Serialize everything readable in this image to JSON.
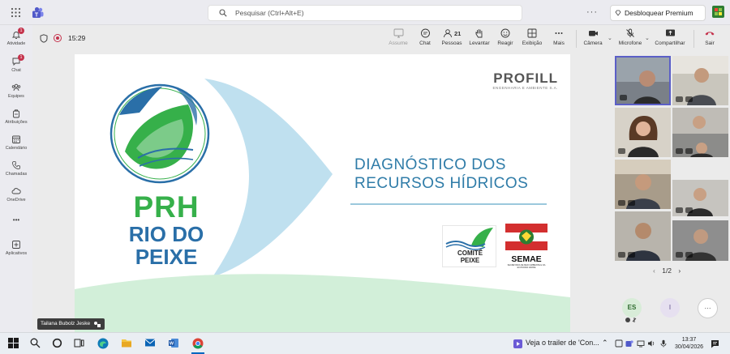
{
  "search": {
    "placeholder": "Pesquisar (Ctrl+Alt+E)"
  },
  "header": {
    "premium_label": "Desbloquear Premium",
    "more": "···"
  },
  "rail": {
    "items": [
      {
        "label": "Atividade",
        "badge": "1"
      },
      {
        "label": "Chat",
        "badge": "1"
      },
      {
        "label": "Equipes"
      },
      {
        "label": "Atribuições"
      },
      {
        "label": "Calendário"
      },
      {
        "label": "Chamadas"
      },
      {
        "label": "OneDrive"
      },
      {
        "label": "•••"
      },
      {
        "label": "Aplicativos"
      }
    ]
  },
  "meeting": {
    "timer": "15:29",
    "toolbar": {
      "assume": "Assume",
      "chat": "Chat",
      "people": "Pessoas",
      "people_count": "21",
      "raise": "Levantar",
      "react": "Reagir",
      "view": "Exibição",
      "more": "Mais",
      "camera": "Câmera",
      "mic": "Microfone",
      "share": "Compartilhar",
      "leave": "Sair"
    }
  },
  "slide": {
    "logo_line1": "PRH",
    "logo_line2": "RIO DO",
    "logo_line3": "PEIXE",
    "brand": "PROFILL",
    "brand_sub": "ENGENHARIA E AMBIENTE S.A.",
    "title_line1": "DIAGNÓSTICO DOS",
    "title_line2": "RECURSOS HÍDRICOS",
    "comite_line1": "COMITÊ",
    "comite_line2": "PEIXE",
    "semae": "SEMAE",
    "semae_sub": "SECRETARIA DE MEIO AMBIENTE E DA ECONOMIA VERDE"
  },
  "gallery": {
    "pager": "1/2",
    "initials1": "ES",
    "initials2": "I",
    "more": "···"
  },
  "presenter": {
    "name": "Tailana Bubolz Jeske"
  },
  "taskbar": {
    "trailer": "Veja o trailer de 'Con...",
    "time": "13:37",
    "date": "30/04/2026"
  },
  "colors": {
    "brand_green": "#36b04a",
    "brand_blue": "#2a6fa8",
    "title_blue": "#2f7ca8",
    "leave_red": "#c4314b"
  }
}
